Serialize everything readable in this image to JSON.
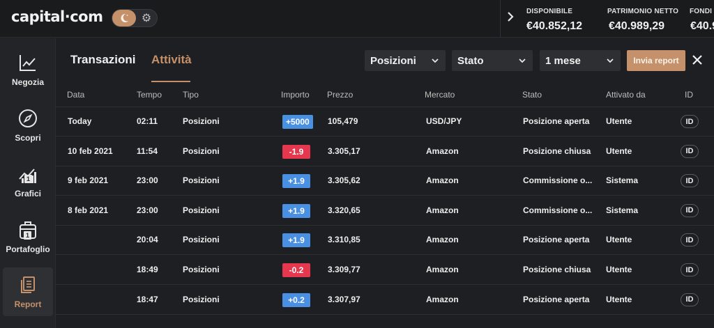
{
  "brand": {
    "logo": "capital·com"
  },
  "account": {
    "items": [
      {
        "label": "DISPONIBILE",
        "value": "€40.852,12"
      },
      {
        "label": "PATRIMONIO NETTO",
        "value": "€40.989,29"
      },
      {
        "label": "FONDI",
        "value": "€40.9"
      }
    ]
  },
  "sidebar": {
    "items": [
      {
        "label": "Negozia",
        "icon": "chart-trend-icon"
      },
      {
        "label": "Scopri",
        "icon": "compass-icon"
      },
      {
        "label": "Grafici",
        "icon": "charts-icon",
        "badge": "1"
      },
      {
        "label": "Portafoglio",
        "icon": "briefcase-icon",
        "badge": "1"
      },
      {
        "label": "Report",
        "icon": "report-icon",
        "active": true
      }
    ]
  },
  "tabs": [
    {
      "label": "Transazioni"
    },
    {
      "label": "Attività",
      "active": true
    }
  ],
  "filters": {
    "type": "Posizioni",
    "status": "Stato",
    "period": "1 mese",
    "report_button": "Invia report"
  },
  "colors": {
    "accent": "#c4916a",
    "positive": "#4a90e2",
    "negative": "#e5384f"
  },
  "table": {
    "headers": [
      "Data",
      "Tempo",
      "Tipo",
      "Importo",
      "Prezzo",
      "Mercato",
      "Stato",
      "Attivato da",
      "ID"
    ],
    "rows": [
      {
        "date": "Today",
        "time": "02:11",
        "type": "Posizioni",
        "amount": "+5000",
        "sign": "pos",
        "price": "105,479",
        "market": "USD/JPY",
        "status": "Posizione aperta",
        "by": "Utente",
        "id": "ID"
      },
      {
        "date": "10 feb 2021",
        "time": "11:54",
        "type": "Posizioni",
        "amount": "-1.9",
        "sign": "neg",
        "price": "3.305,17",
        "market": "Amazon",
        "status": "Posizione chiusa",
        "by": "Utente",
        "id": "ID"
      },
      {
        "date": "9 feb 2021",
        "time": "23:00",
        "type": "Posizioni",
        "amount": "+1.9",
        "sign": "pos",
        "price": "3.305,62",
        "market": "Amazon",
        "status": "Commissione o...",
        "by": "Sistema",
        "id": "ID"
      },
      {
        "date": "8 feb 2021",
        "time": "23:00",
        "type": "Posizioni",
        "amount": "+1.9",
        "sign": "pos",
        "price": "3.320,65",
        "market": "Amazon",
        "status": "Commissione o...",
        "by": "Sistema",
        "id": "ID"
      },
      {
        "date": "",
        "time": "20:04",
        "type": "Posizioni",
        "amount": "+1.9",
        "sign": "pos",
        "price": "3.310,85",
        "market": "Amazon",
        "status": "Posizione aperta",
        "by": "Utente",
        "id": "ID"
      },
      {
        "date": "",
        "time": "18:49",
        "type": "Posizioni",
        "amount": "-0.2",
        "sign": "neg",
        "price": "3.309,77",
        "market": "Amazon",
        "status": "Posizione chiusa",
        "by": "Utente",
        "id": "ID"
      },
      {
        "date": "",
        "time": "18:47",
        "type": "Posizioni",
        "amount": "+0.2",
        "sign": "pos",
        "price": "3.307,97",
        "market": "Amazon",
        "status": "Posizione aperta",
        "by": "Utente",
        "id": "ID"
      }
    ]
  }
}
